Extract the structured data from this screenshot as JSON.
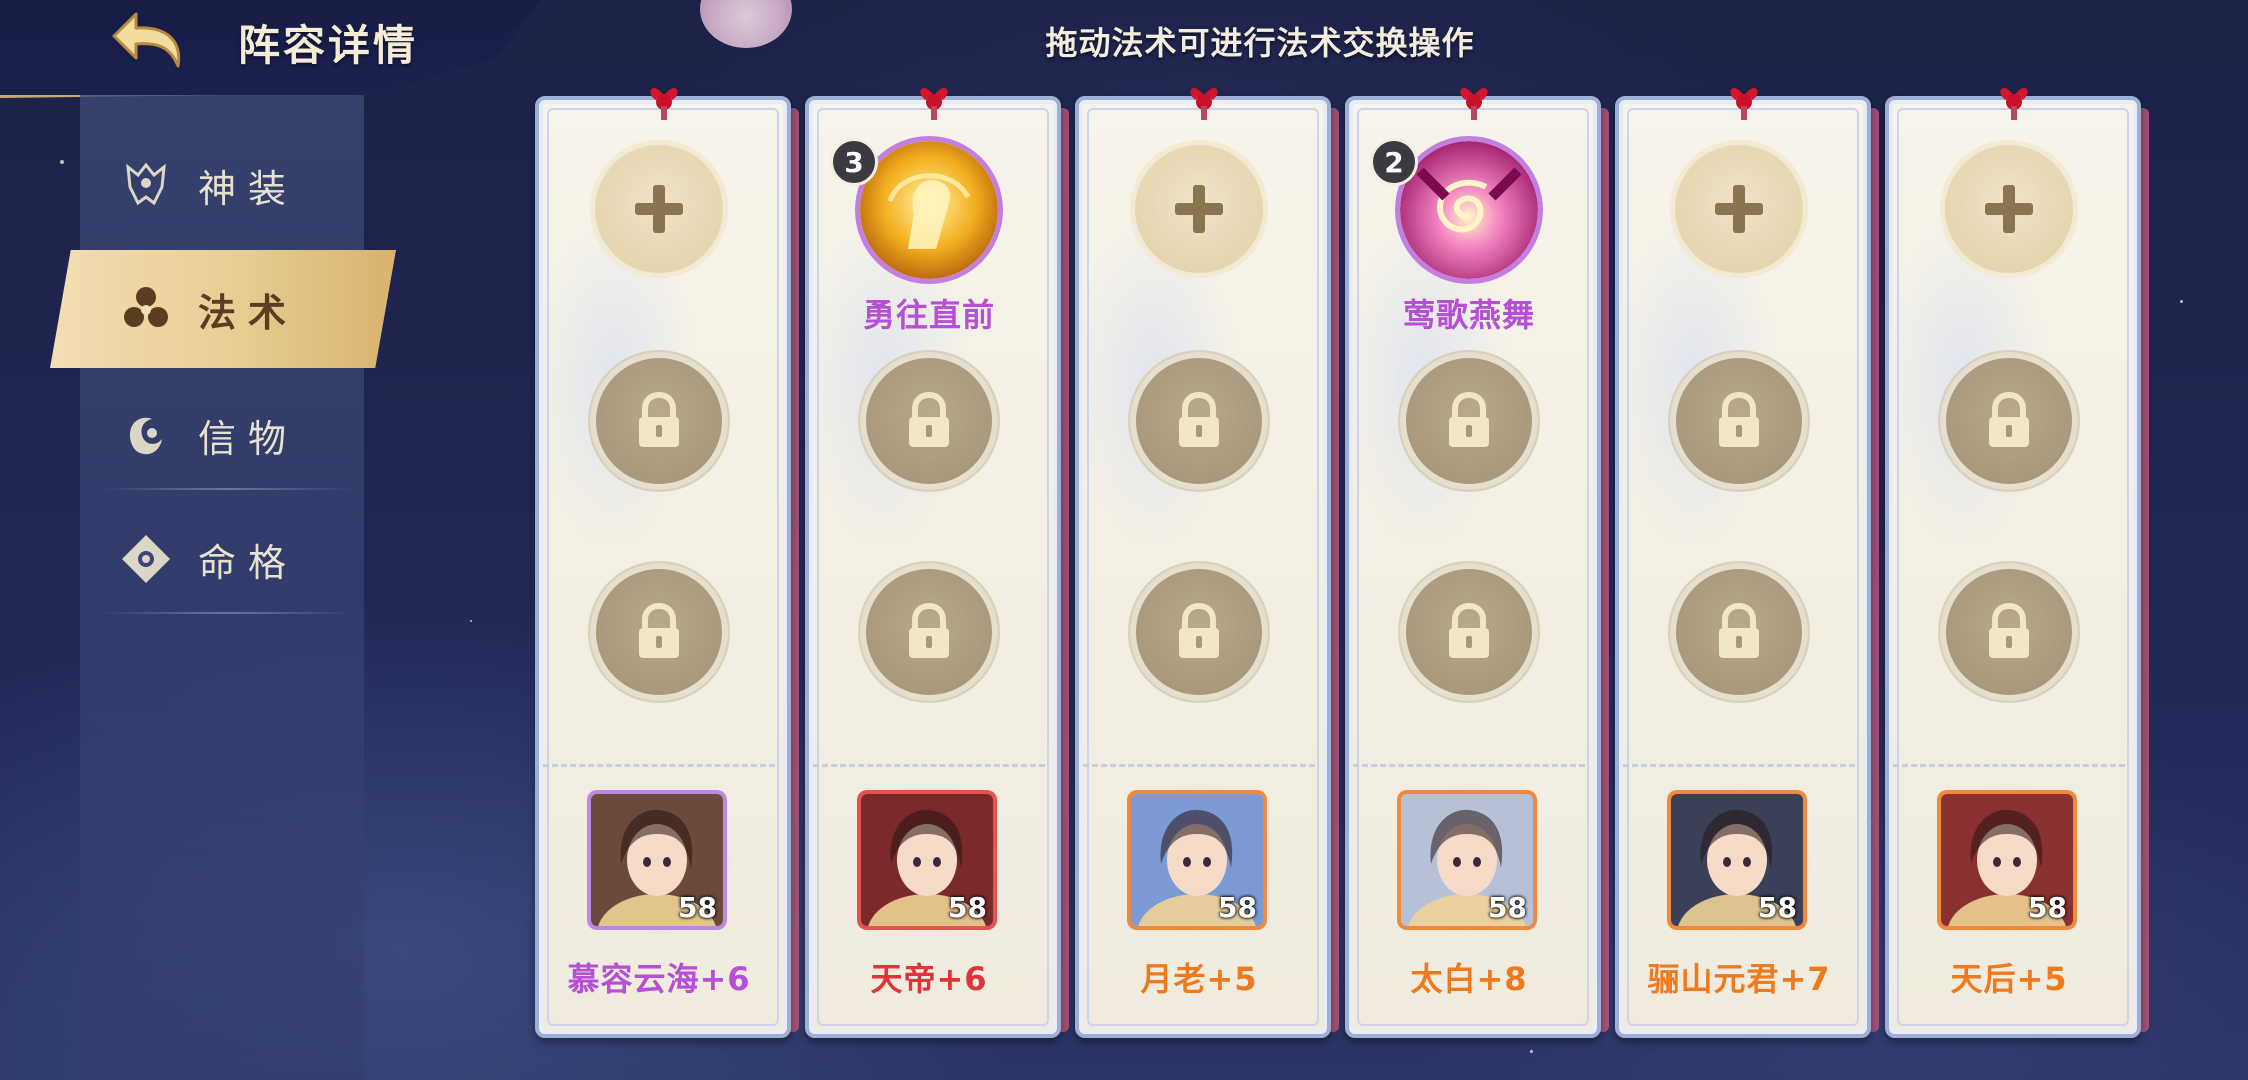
{
  "header": {
    "title": "阵容详情",
    "hint": "拖动法术可进行法术交换操作"
  },
  "sidebar": {
    "items": [
      {
        "label": "神装",
        "icon": "armor-icon",
        "active": false
      },
      {
        "label": "法术",
        "icon": "spell-icon",
        "active": true
      },
      {
        "label": "信物",
        "icon": "token-icon",
        "active": false
      },
      {
        "label": "命格",
        "icon": "fate-icon",
        "active": false
      }
    ]
  },
  "cards": [
    {
      "slot1": "add",
      "hero": {
        "name": "慕容云海+6",
        "level": "58",
        "name_color": "#b64fd6",
        "frame": "#b98ae0",
        "bg": "#6a4a3a"
      }
    },
    {
      "slot1": "spell",
      "spell": {
        "name": "勇往直前",
        "level": "3",
        "kind": "fist",
        "color": "#f0a020"
      },
      "hero": {
        "name": "天帝+6",
        "level": "58",
        "name_color": "#e0343a",
        "frame": "#e55350",
        "bg": "#7a2a2a"
      }
    },
    {
      "slot1": "add",
      "hero": {
        "name": "月老+5",
        "level": "58",
        "name_color": "#ef7a1e",
        "frame": "#f08a3a",
        "bg": "#7c9ad4"
      }
    },
    {
      "slot1": "spell",
      "spell": {
        "name": "莺歌燕舞",
        "level": "2",
        "kind": "swirl",
        "color": "#e83d9e"
      },
      "hero": {
        "name": "太白+8",
        "level": "58",
        "name_color": "#ef7a1e",
        "frame": "#f08a3a",
        "bg": "#b6c1d8"
      }
    },
    {
      "slot1": "add",
      "hero": {
        "name": "骊山元君+7",
        "level": "58",
        "name_color": "#ef7a1e",
        "frame": "#f08a3a",
        "bg": "#3a4058"
      }
    },
    {
      "slot1": "add",
      "hero": {
        "name": "天后+5",
        "level": "58",
        "name_color": "#ef7a1e",
        "frame": "#f08a3a",
        "bg": "#8a3030"
      }
    }
  ]
}
